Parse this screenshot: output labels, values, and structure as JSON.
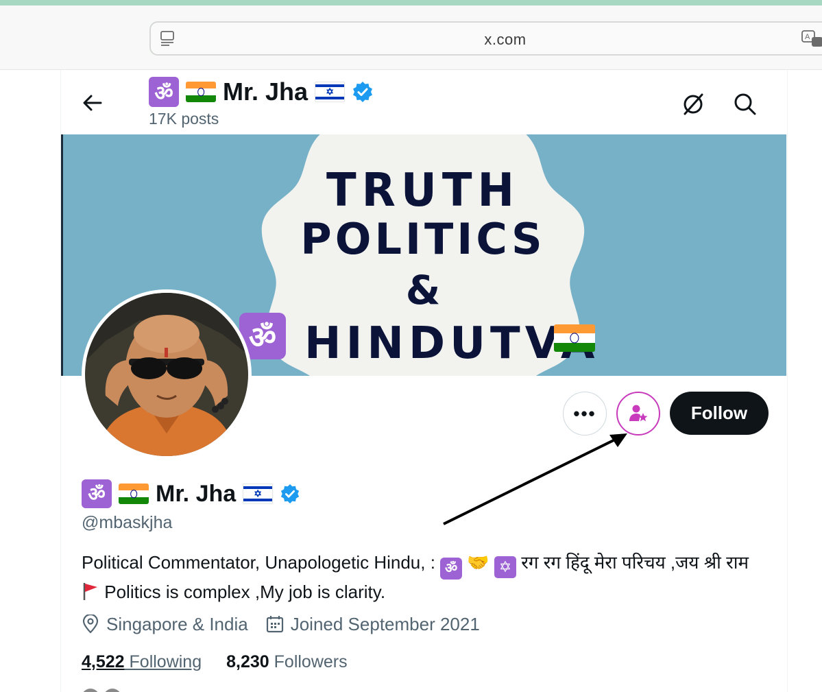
{
  "browser": {
    "url": "x.com",
    "reader_icon": "reader-view-icon",
    "translate_icon": "translate-icon"
  },
  "header": {
    "name": "Mr. Jha",
    "posts": "17K posts",
    "back_icon": "arrow-left-icon",
    "grok_icon": "grok-icon",
    "search_icon": "search-icon"
  },
  "banner": {
    "line1": "TRUTH",
    "line2": "POLITICS",
    "line3": "&",
    "line4": "HINDUTVA",
    "background": "#76b1c7"
  },
  "actions": {
    "more_label": "•••",
    "follow_label": "Follow",
    "subscribe_icon": "subscribe-person-star-icon",
    "subscribe_color": "#c93bbd"
  },
  "profile": {
    "name": "Mr. Jha",
    "handle": "@mbaskjha",
    "bio_part1": "Political Commentator, Unapologetic Hindu, : ",
    "bio_part2": " रग रग हिंदू मेरा परिचय ,जय श्री राम ",
    "bio_part3": " Politics is complex ,My job is clarity.",
    "location": "Singapore & India",
    "joined": "Joined September 2021",
    "following_count": "4,522",
    "following_label": "Following",
    "followers_count": "8,230",
    "followers_label": "Followers"
  },
  "glyphs": {
    "om": "ॐ",
    "star_of_david": "✡",
    "handshake": "🤝"
  },
  "colors": {
    "verified": "#1d9bf0",
    "om_badge": "#9d62d3",
    "follow_bg": "#0f1419",
    "secondary_text": "#536471"
  }
}
